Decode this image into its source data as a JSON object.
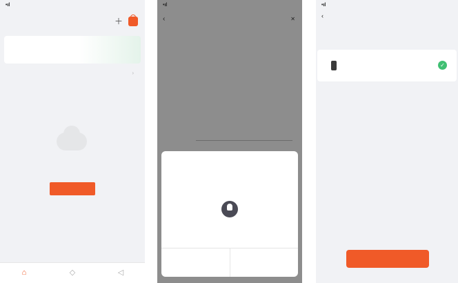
{
  "colors": {
    "accent": "#f05a28",
    "success": "#3fbf72"
  },
  "screen1": {
    "status": {
      "signal": "•ıl ",
      "time": "",
      "battery": ""
    },
    "title": "",
    "icons": {
      "add": "add-icon",
      "cart": "bag-icon"
    },
    "banner": {
      "line1": "",
      "line2": ""
    },
    "section_label": "",
    "empty_text": "",
    "add_device_button": "",
    "tabs": [
      {
        "icon": "home-icon",
        "glyph": "⌂",
        "label": ""
      },
      {
        "icon": "smart-icon",
        "glyph": "◇",
        "label": ""
      },
      {
        "icon": "profile-icon",
        "glyph": "◁",
        "label": ""
      }
    ]
  },
  "screen2": {
    "status": {
      "signal": "•ıl ",
      "time": "",
      "battery": ""
    },
    "header": {
      "back": "‹",
      "title": "",
      "close": "✕"
    },
    "red_label": "",
    "subtitle": "",
    "grid_rows": [
      {
        "label": "",
        "c1": "",
        "c2": "",
        "c3": ""
      },
      {
        "label": "",
        "c1": "",
        "c2": "",
        "c3": ""
      },
      {
        "label": "",
        "c1": "",
        "c2": "",
        "c3": ""
      },
      {
        "label": "",
        "c1": "",
        "c2": "",
        "c3": ""
      }
    ],
    "modal": {
      "title": "",
      "hint": "",
      "left_button": "",
      "right_button": ""
    }
  },
  "screen3": {
    "status": {
      "signal": "•ıl ",
      "time": "",
      "battery": ""
    },
    "header": "‹",
    "hint": "",
    "device": {
      "name": "",
      "selected": true
    },
    "next_button": ""
  }
}
